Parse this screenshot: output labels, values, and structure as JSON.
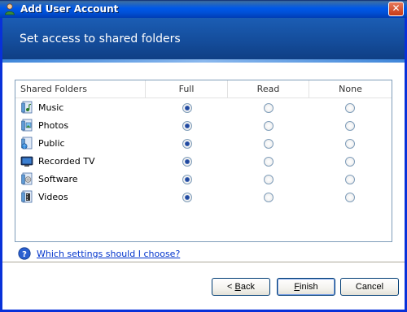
{
  "window": {
    "title": "Add User Account",
    "close_glyph": "✕"
  },
  "banner": {
    "title": "Set access to shared folders"
  },
  "table": {
    "headers": [
      "Shared Folders",
      "Full",
      "Read",
      "None"
    ],
    "rows": [
      {
        "name": "Music",
        "icon": "music-folder-icon",
        "access": "Full"
      },
      {
        "name": "Photos",
        "icon": "photos-folder-icon",
        "access": "Full"
      },
      {
        "name": "Public",
        "icon": "public-folder-icon",
        "access": "Full"
      },
      {
        "name": "Recorded TV",
        "icon": "recorded-tv-folder-icon",
        "access": "Full"
      },
      {
        "name": "Software",
        "icon": "software-folder-icon",
        "access": "Full"
      },
      {
        "name": "Videos",
        "icon": "videos-folder-icon",
        "access": "Full"
      }
    ]
  },
  "help": {
    "link_text": "Which settings should I choose?"
  },
  "buttons": {
    "back_prefix": "< ",
    "back_mnemonic": "B",
    "back_rest": "ack",
    "finish_mnemonic": "F",
    "finish_rest": "inish",
    "cancel_label": "Cancel"
  },
  "colors": {
    "banner": "#144c9a",
    "link": "#0033cc",
    "radio_dot": "#21479d"
  }
}
